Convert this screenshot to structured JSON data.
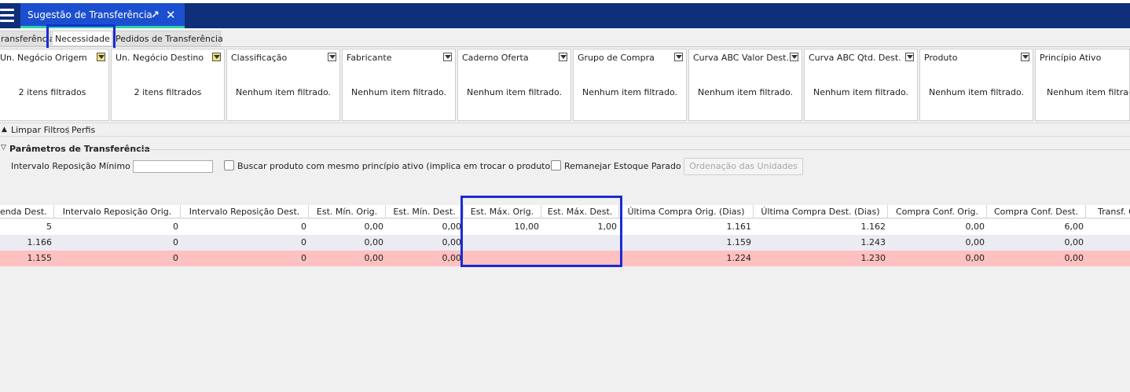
{
  "app_tab": {
    "title": "Sugestão de Transferência",
    "pin_glyph": "↗",
    "close_glyph": "✕"
  },
  "subtabs": [
    "ransferência",
    "Necessidade",
    "Pedidos de Transferência"
  ],
  "filters": [
    {
      "name": "Un. Negócio Origem",
      "value": "2 itens filtrados",
      "active": true
    },
    {
      "name": "Un. Negócio Destino",
      "value": "2 itens filtrados",
      "active": true
    },
    {
      "name": "Classificação",
      "value": "Nenhum item filtrado.",
      "active": false
    },
    {
      "name": "Fabricante",
      "value": "Nenhum item filtrado.",
      "active": false
    },
    {
      "name": "Caderno Oferta",
      "value": "Nenhum item filtrado.",
      "active": false
    },
    {
      "name": "Grupo de Compra",
      "value": "Nenhum item filtrado.",
      "active": false
    },
    {
      "name": "Curva ABC Valor Dest.",
      "value": "Nenhum item filtrado.",
      "active": false
    },
    {
      "name": "Curva ABC Qtd. Dest.",
      "value": "Nenhum item filtrado.",
      "active": false
    },
    {
      "name": "Produto",
      "value": "Nenhum item filtrado.",
      "active": false
    },
    {
      "name": "Princípio Ativo",
      "value": "Nenhum item filtrad",
      "active": false
    }
  ],
  "tools": {
    "clear_filters": "Limpar Filtros",
    "profiles": "Perfis"
  },
  "params": {
    "title": "Parâmetros de Transferência",
    "interval_label": "Intervalo Reposição Mínimo",
    "interval_value": "",
    "same_active_label": "Buscar produto com mesmo princípio ativo (implica em trocar o produto)",
    "same_active_checked": false,
    "relocate_label": "Remanejar Estoque Parado",
    "relocate_checked": false,
    "order_button": "Ordenação das Unidades"
  },
  "table": {
    "columns": [
      "enda Dest.",
      "Intervalo Reposição Orig.",
      "Intervalo Reposição Dest.",
      "Est. Mín. Orig.",
      "Est. Mín. Dest.",
      "Est. Máx. Orig.",
      "Est. Máx. Dest.",
      "Última Compra Orig. (Dias)",
      "Última Compra Dest. (Dias)",
      "Compra Conf. Orig.",
      "Compra Conf. Dest.",
      "Transf. C"
    ],
    "rows": [
      [
        "5",
        "0",
        "0",
        "0,00",
        "0,00",
        "10,00",
        "1,00",
        "1.161",
        "1.162",
        "0,00",
        "6,00",
        ""
      ],
      [
        "1.166",
        "0",
        "0",
        "0,00",
        "0,00",
        "",
        "",
        "1.159",
        "1.243",
        "0,00",
        "0,00",
        ""
      ],
      [
        "1.155",
        "0",
        "0",
        "0,00",
        "0,00",
        "",
        "",
        "1.224",
        "1.230",
        "0,00",
        "0,00",
        ""
      ]
    ],
    "row_colors": [
      "#ffffff",
      "#ebebf3",
      "#ffc0c0"
    ]
  },
  "colors": {
    "header_blue": "#0f2f7a",
    "active_tab": "#1c4fcf",
    "highlight_box": "#1a2bd6"
  }
}
